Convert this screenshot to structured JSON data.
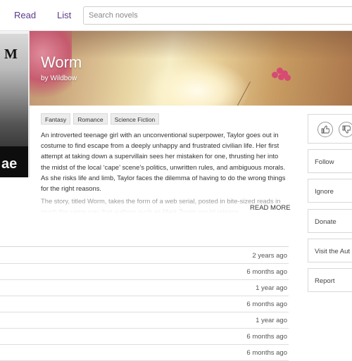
{
  "nav": {
    "read_label": "Read",
    "list_label": "List"
  },
  "search": {
    "placeholder": "Search novels"
  },
  "novel": {
    "title": "Worm",
    "author": "by Wildbow",
    "cover_text": "ae",
    "cover_mark": "M",
    "tags": [
      "Fantasy",
      "Romance",
      "Science Fiction"
    ],
    "description": "An introverted teenage girl with an unconventional superpower, Taylor goes out in costume to find escape from a deeply unhappy and frustrated civilian life. Her first attempt at taking down a supervillain sees her mistaken for one, thrusting her into the midst of the local ‘cape’ scene’s politics, unwritten rules, and ambiguous morals. As she risks life and limb, Taylor faces the dilemma of having to do the wrong things for the right reasons.",
    "description_more": "The story, titled Worm, takes the form of a web serial, posted in bite-sized reads in much the same way that authors such as Mark Twain would release",
    "read_more_label": "READ MORE"
  },
  "chapters": [
    {
      "date": "2 years ago"
    },
    {
      "date": "6 months ago"
    },
    {
      "date": "1 year ago"
    },
    {
      "date": "6 months ago"
    },
    {
      "date": "1 year ago"
    },
    {
      "date": "6 months ago"
    },
    {
      "date": "6 months ago"
    }
  ],
  "sidebar": {
    "follow_label": "Follow",
    "ignore_label": "Ignore",
    "donate_label": "Donate",
    "visit_label": "Visit the Aut",
    "report_label": "Report"
  },
  "colors": {
    "accent": "#5b3a8c"
  }
}
